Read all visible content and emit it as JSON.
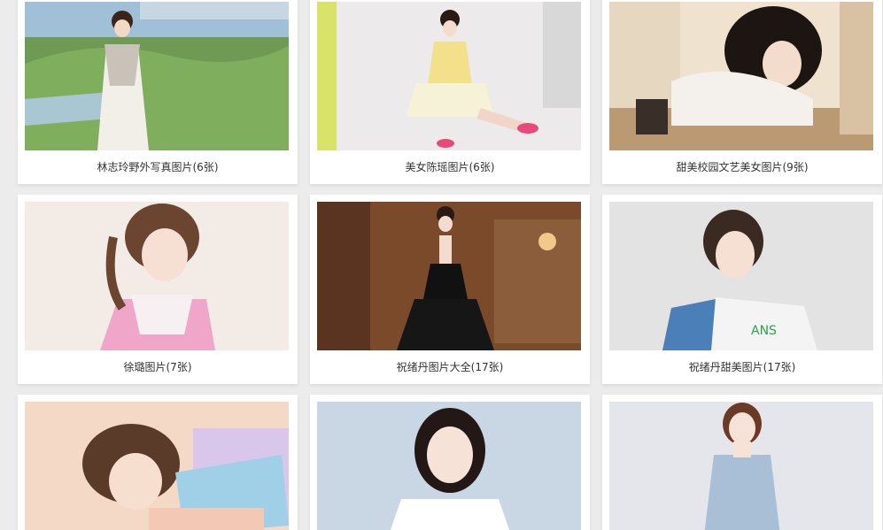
{
  "gallery": {
    "albums": [
      {
        "title": "林志玲野外写真图片(6张)",
        "thumb_bg": "#6f9a53",
        "thumb_accent": "#f2efe8"
      },
      {
        "title": "美女陈瑶图片(6张)",
        "thumb_bg": "#eceaea",
        "thumb_accent": "#f3e08a"
      },
      {
        "title": "甜美校园文艺美女图片(9张)",
        "thumb_bg": "#d9c2a4",
        "thumb_accent": "#f4f1ec"
      },
      {
        "title": "徐璐图片(7张)",
        "thumb_bg": "#f3ece6",
        "thumb_accent": "#f0a6c8"
      },
      {
        "title": "祝绪丹图片大全(17张)",
        "thumb_bg": "#7a4a2a",
        "thumb_accent": "#111111"
      },
      {
        "title": "祝绪丹甜美图片(17张)",
        "thumb_bg": "#e3e3e3",
        "thumb_accent": "#4a7fb8"
      },
      {
        "title": "",
        "thumb_bg": "#f4d9c6",
        "thumb_accent": "#9fd0e8"
      },
      {
        "title": "",
        "thumb_bg": "#c9d6e4",
        "thumb_accent": "#ffffff"
      },
      {
        "title": "",
        "thumb_bg": "#e4e6ec",
        "thumb_accent": "#a9bfd6"
      }
    ]
  }
}
